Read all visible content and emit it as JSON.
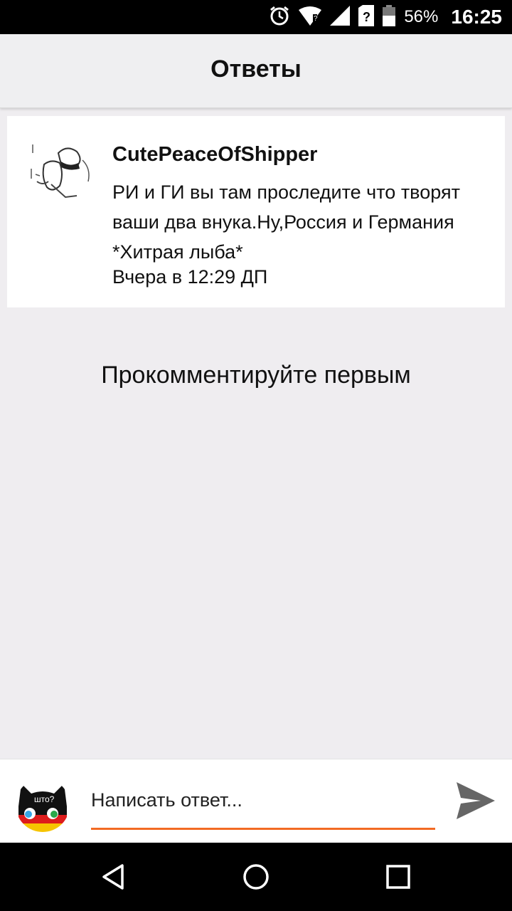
{
  "status_bar": {
    "battery": "56%",
    "time": "16:25",
    "icons": [
      "alarm-icon",
      "wifi-icon",
      "signal-icon",
      "unknown-sim-icon",
      "battery-icon"
    ]
  },
  "header": {
    "title": "Ответы"
  },
  "post": {
    "author": "CutePeaceOfShipper",
    "text": "РИ и ГИ вы там проследите что творят ваши два внука.Ну,Россия и Германия *Хитрая лыба*",
    "time": "Вчера в 12:29 ДП"
  },
  "empty_state": "Прокомментируйте первым",
  "reply": {
    "placeholder": "Написать ответ...",
    "accent_color": "#f26a24",
    "avatar_label": "што?"
  },
  "nav": [
    "back-icon",
    "home-icon",
    "recents-icon"
  ]
}
